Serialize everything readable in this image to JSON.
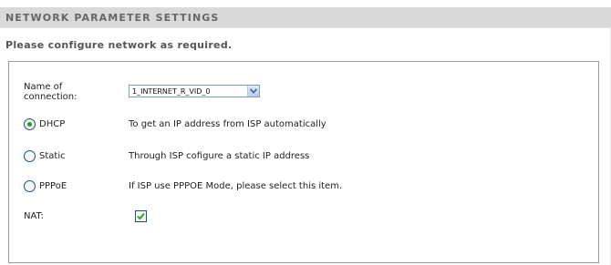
{
  "header": {
    "title": "NETWORK PARAMETER SETTINGS"
  },
  "subtitle": "Please configure network as required.",
  "connection": {
    "label": "Name of connection:",
    "selected_value": "1_INTERNET_R_VID_0"
  },
  "modes": [
    {
      "label": "DHCP",
      "description": "To get an IP address from ISP automatically",
      "selected": true
    },
    {
      "label": "Static",
      "description": "Through ISP cofigure a static IP address",
      "selected": false
    },
    {
      "label": "PPPoE",
      "description": "If ISP use PPPOE Mode, please select this item.",
      "selected": false
    }
  ],
  "nat": {
    "label": "NAT:",
    "checked": true
  },
  "icons": {
    "radio_selected": "radio-selected-icon",
    "radio_unselected": "radio-unselected-icon",
    "checkbox_checked": "checkmark-icon",
    "dropdown": "chevron-down-icon"
  },
  "colors": {
    "header_bg": "#d9d9d9",
    "header_text": "#666666",
    "panel_border": "#9a9a9a",
    "radio_dot": "#21a121",
    "check_mark": "#21a121"
  }
}
